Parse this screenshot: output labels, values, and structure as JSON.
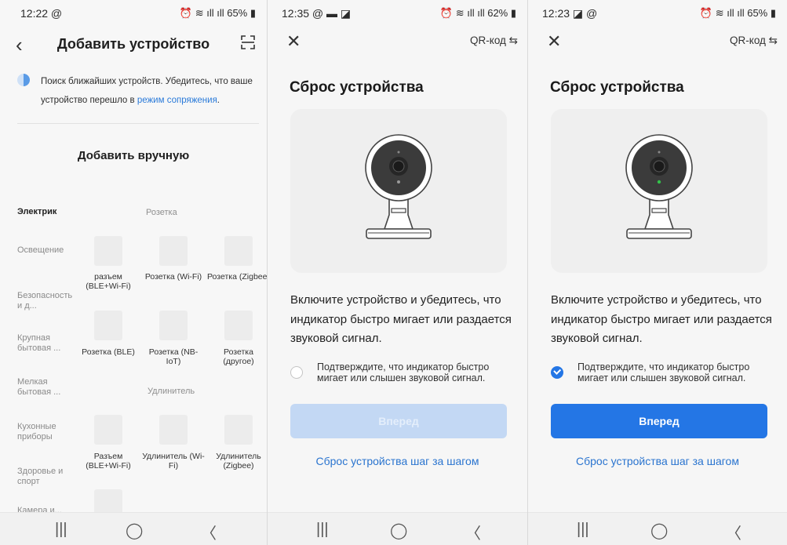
{
  "screen1": {
    "status": {
      "time": "12:22 @",
      "right": "⏰ ≋ ıll ıll 65% ▮"
    },
    "title": "Добавить устройство",
    "info_text": "Поиск ближайших устройств. Убедитесь, что ваше устройство перешло в ",
    "info_link": "режим сопряжения",
    "info_end": ".",
    "manual_title": "Добавить вручную",
    "categories": [
      "Электрик",
      "Освещение",
      "Безопасность и д...",
      "Крупная бытовая ...",
      "Мелкая бытовая ...",
      "Кухонные приборы",
      "Здоровье и спорт",
      "Камера и..."
    ],
    "section_socket": "Розетка",
    "section_extender": "Удлинитель",
    "tiles": [
      {
        "label": "разъем (BLE+Wi-Fi)"
      },
      {
        "label": "Розетка (Wi-Fi)"
      },
      {
        "label": "Розетка (Zigbee)"
      },
      {
        "label": "Розетка (BLE)"
      },
      {
        "label": "Розетка (NB-IoT)"
      },
      {
        "label": "Розетка (другое)"
      },
      {
        "label": "Разъем (BLE+Wi-Fi)"
      },
      {
        "label": "Удлинитель (Wi-Fi)"
      },
      {
        "label": "Удлинитель (Zigbee)"
      }
    ]
  },
  "screen2": {
    "status": {
      "time": "12:35 @ ▬ ◪",
      "right": "⏰ ≋ ıll ıll 62% ▮"
    },
    "qr_label": "QR-код ⇆",
    "title": "Сброс устройства",
    "description": "Включите устройство и убедитесь, что индикатор быстро мигает или раздается звуковой сигнал.",
    "confirm": "Подтверждите, что индикатор быстро мигает или слышен звуковой сигнал.",
    "confirm_checked": false,
    "next_label": "Вперед",
    "step_link": "Сброс устройства шаг за шагом"
  },
  "screen3": {
    "status": {
      "time": "12:23 ◪ @",
      "right": "⏰ ≋ ıll ıll 65% ▮"
    },
    "qr_label": "QR-код ⇆",
    "title": "Сброс устройства",
    "description": "Включите устройство и убедитесь, что индикатор быстро мигает или раздается звуковой сигнал.",
    "confirm": "Подтверждите, что индикатор быстро мигает или слышен звуковой сигнал.",
    "confirm_checked": true,
    "next_label": "Вперед",
    "step_link": "Сброс устройства шаг за шагом"
  },
  "navbar": {
    "recent": "|||",
    "home": "◯",
    "back": "〈"
  },
  "colors": {
    "accent": "#2476e5",
    "accent_disabled": "#c3d8f4",
    "link": "#2a74cf",
    "led_green": "#33c24a"
  }
}
